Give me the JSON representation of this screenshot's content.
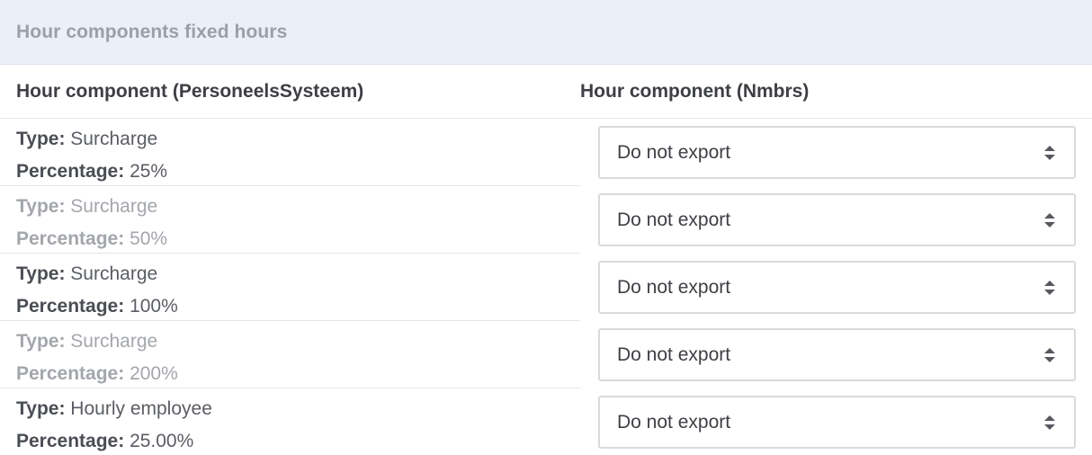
{
  "panel": {
    "title": "Hour components fixed hours"
  },
  "table": {
    "headers": {
      "left": "Hour component (PersoneelsSysteem)",
      "right": "Hour component (Nmbrs)"
    },
    "type_label": "Type:",
    "percentage_label": "Percentage:",
    "rows": [
      {
        "type": "Surcharge",
        "percentage": "25%",
        "selected": "Do not export"
      },
      {
        "type": "Surcharge",
        "percentage": "50%",
        "selected": "Do not export"
      },
      {
        "type": "Surcharge",
        "percentage": "100%",
        "selected": "Do not export"
      },
      {
        "type": "Surcharge",
        "percentage": "200%",
        "selected": "Do not export"
      },
      {
        "type": "Hourly employee",
        "percentage": "25.00%",
        "selected": "Do not export"
      }
    ]
  },
  "icons": {
    "select_caret": "sort-up-down-icon"
  },
  "colors": {
    "header_background": "#ebf0f8",
    "title_text": "#9aa0a8",
    "muted_text": "#a3a6ab",
    "primary_text": "#3d3f44"
  }
}
